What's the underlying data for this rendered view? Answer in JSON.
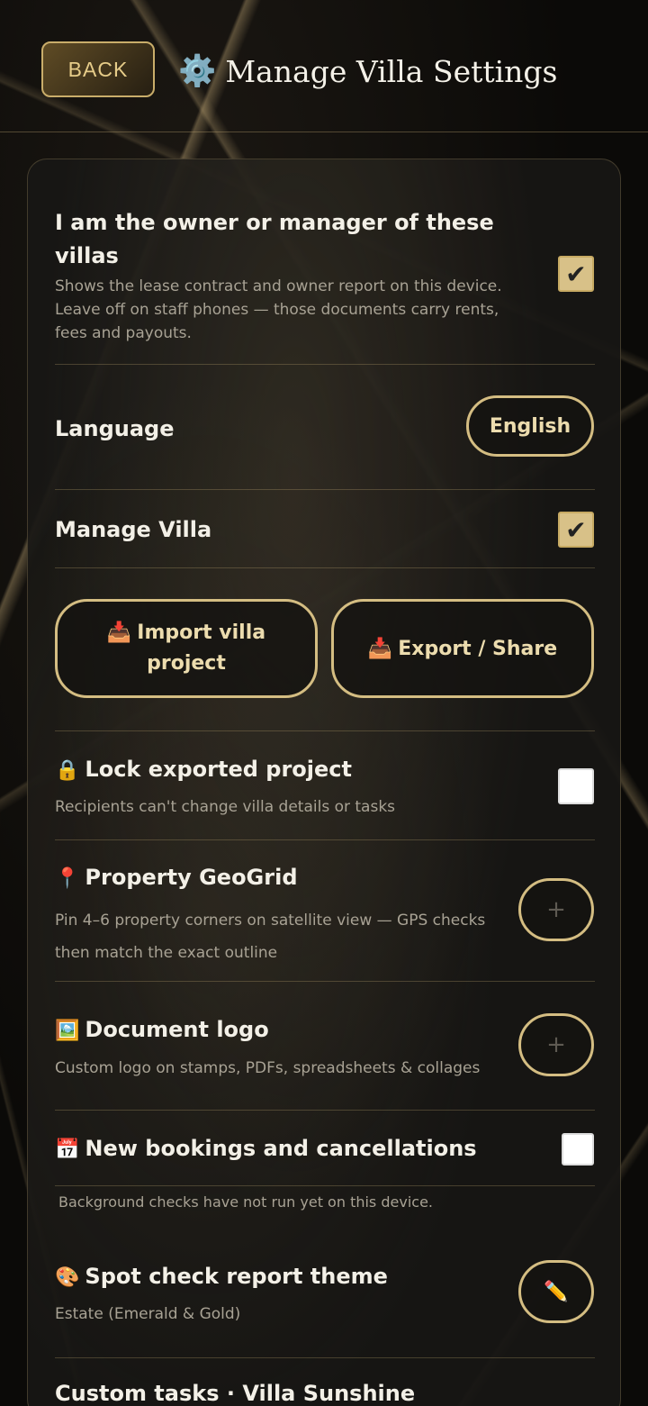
{
  "header": {
    "back_label": "BACK",
    "title": "Manage Villa Settings"
  },
  "owner": {
    "title_line1": "I am the owner or manager of these",
    "title_line2": "villas",
    "desc_line1": "Shows the lease contract and owner report on this device.",
    "desc_line2": "Leave off on staff phones — those documents carry rents,",
    "desc_line3": "fees and payouts.",
    "checked": true
  },
  "language": {
    "label": "Language",
    "value": "English"
  },
  "manage_villa": {
    "label": "Manage Villa",
    "checked": true
  },
  "project_buttons": {
    "import_line1": "Import villa",
    "import_line2": "project",
    "export_label": "Export / Share"
  },
  "lock_project": {
    "title": "Lock exported project",
    "desc": "Recipients can't change villa details or tasks",
    "checked": false
  },
  "geogrid": {
    "title": "Property GeoGrid",
    "desc_line1": "Pin 4–6 property corners on satellite view — GPS checks",
    "desc_line2": "then match the exact outline",
    "button_symbol": "+"
  },
  "document_logo": {
    "title": "Document logo",
    "desc": "Custom logo on stamps, PDFs, spreadsheets & collages",
    "button_symbol": "+"
  },
  "bookings": {
    "title": "New bookings and cancellations",
    "status": "Background checks have not run yet on this device.",
    "checked": false
  },
  "spot_check": {
    "title": "Spot check report theme",
    "value": "Estate (Emerald & Gold)"
  },
  "custom_tasks": {
    "title": "Custom tasks · Villa Sunshine"
  },
  "icons": {
    "gear": "⚙️",
    "inbox": "📥",
    "lock": "🔒",
    "pin": "📍",
    "picture": "🖼️",
    "calendar": "📅",
    "palette": "🎨",
    "pencil": "✏️",
    "check": "✔"
  },
  "colors": {
    "accent_gold": "#d4bd82",
    "panel_bg": "#181714",
    "text_primary": "#f3f0e7",
    "text_muted": "#a8a294"
  }
}
